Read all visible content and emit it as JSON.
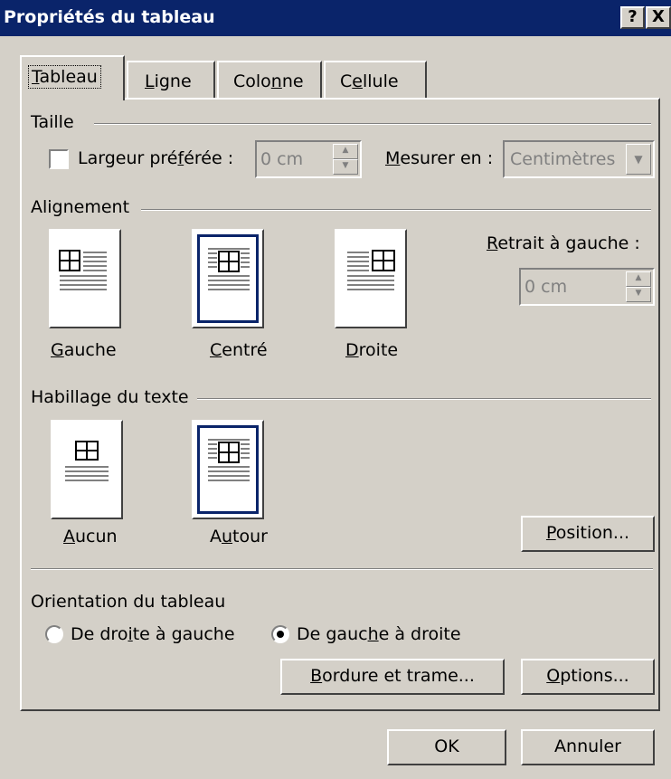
{
  "title": "Propriétés du tableau",
  "title_buttons": {
    "help": "?",
    "close": "X"
  },
  "tabs": [
    {
      "pre": "",
      "u": "T",
      "post": "ableau"
    },
    {
      "pre": "",
      "u": "L",
      "post": "igne"
    },
    {
      "pre": "Colo",
      "u": "n",
      "post": "ne"
    },
    {
      "pre": "C",
      "u": "e",
      "post": "llule"
    }
  ],
  "taille": {
    "legend": "Taille",
    "checkbox": {
      "pre": "Largeur pré",
      "u": "f",
      "post": "érée :",
      "checked": false
    },
    "width_value": "0 cm",
    "measure": {
      "pre": "",
      "u": "M",
      "post": "esurer en :"
    },
    "measure_value": "Centimètres"
  },
  "alignement": {
    "legend": "Alignement",
    "options": [
      {
        "pre": "",
        "u": "G",
        "post": "auche",
        "selected": false
      },
      {
        "pre": "",
        "u": "C",
        "post": "entré",
        "selected": true
      },
      {
        "pre": "",
        "u": "D",
        "post": "roite",
        "selected": false
      }
    ],
    "retrait": {
      "pre": "",
      "u": "R",
      "post": "etrait à gauche :"
    },
    "retrait_value": "0 cm"
  },
  "habillage": {
    "legend": "Habillage du texte",
    "options": [
      {
        "pre": "",
        "u": "A",
        "post": "ucun",
        "selected": false
      },
      {
        "pre": "A",
        "u": "u",
        "post": "tour",
        "selected": true
      }
    ],
    "position": {
      "pre": "",
      "u": "P",
      "post": "osition..."
    }
  },
  "orientation": {
    "legend": "Orientation du tableau",
    "radios": [
      {
        "pre": "De dro",
        "u": "i",
        "post": "te à gauche",
        "checked": false
      },
      {
        "pre": "De gauc",
        "u": "h",
        "post": "e à droite",
        "checked": true
      }
    ],
    "bordure": {
      "pre": "",
      "u": "B",
      "post": "ordure et trame..."
    },
    "options": {
      "pre": "",
      "u": "O",
      "post": "ptions..."
    }
  },
  "footer": {
    "ok": "OK",
    "cancel": "Annuler"
  }
}
